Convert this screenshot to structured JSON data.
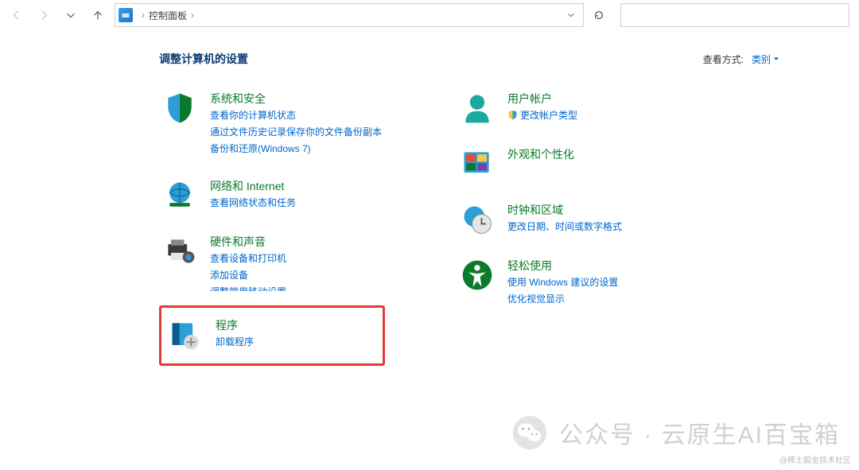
{
  "nav": {
    "breadcrumb_root": "控制面板",
    "search_placeholder": ""
  },
  "header": {
    "title": "调整计算机的设置",
    "view_label": "查看方式:",
    "view_value": "类别"
  },
  "left_categories": [
    {
      "key": "system-security",
      "title": "系统和安全",
      "links": [
        "查看你的计算机状态",
        "通过文件历史记录保存你的文件备份副本",
        "备份和还原(Windows 7)"
      ]
    },
    {
      "key": "network-internet",
      "title": "网络和 Internet",
      "links": [
        "查看网络状态和任务"
      ]
    },
    {
      "key": "hardware-sound",
      "title": "硬件和声音",
      "links": [
        "查看设备和打印机",
        "添加设备",
        "调整常用移动设置"
      ]
    },
    {
      "key": "programs",
      "title": "程序",
      "links": [
        "卸载程序"
      ],
      "highlight": true
    }
  ],
  "right_categories": [
    {
      "key": "user-accounts",
      "title": "用户帐户",
      "links": [
        "更改帐户类型"
      ],
      "links_shield": [
        true
      ]
    },
    {
      "key": "appearance",
      "title": "外观和个性化",
      "links": []
    },
    {
      "key": "clock-region",
      "title": "时钟和区域",
      "links": [
        "更改日期、时间或数字格式"
      ]
    },
    {
      "key": "ease-access",
      "title": "轻松使用",
      "links": [
        "使用 Windows 建议的设置",
        "优化视觉显示"
      ]
    }
  ],
  "watermark": "公众号 · 云原生AI百宝箱",
  "attribution": "@稀土掘金技术社区"
}
